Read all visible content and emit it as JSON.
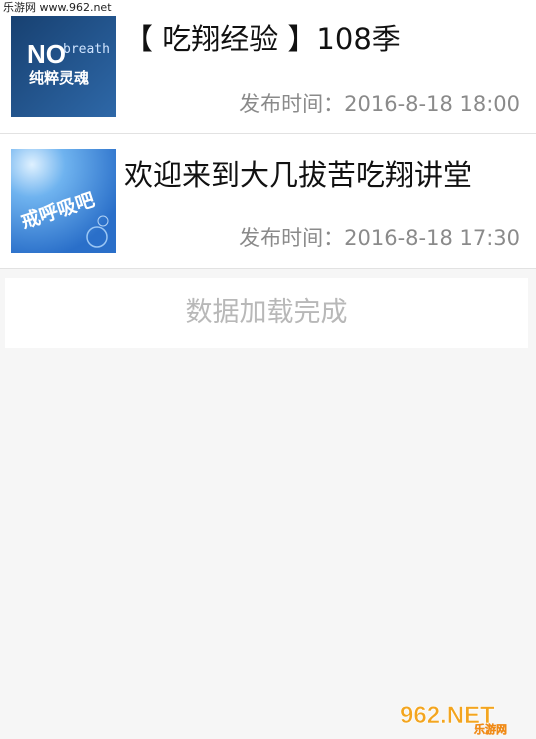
{
  "watermark": {
    "top_text": "乐游网 www.962.net",
    "bottom_logo_main": "962.NET",
    "bottom_logo_sub": "乐游网"
  },
  "articles": [
    {
      "title": "【 吃翔经验 】108季",
      "meta_label": "发布时间：",
      "published": "2016-8-18 18:00",
      "thumb_text_1": "NO",
      "thumb_text_2": "breath",
      "thumb_text_3": "纯粹灵魂"
    },
    {
      "title": "欢迎来到大几拔苦吃翔讲堂",
      "meta_label": "发布时间：",
      "published": "2016-8-18 17:30",
      "thumb_text_1": "戒呼吸吧"
    }
  ],
  "load_status": "数据加载完成",
  "colors": {
    "background": "#f6f6f6",
    "title_text": "#111111",
    "meta_text": "#8a8a8a",
    "status_text": "#b8b8b8",
    "thumb1_bg": "#1f4f8a",
    "thumb2_bg": "#3f8fe0"
  }
}
